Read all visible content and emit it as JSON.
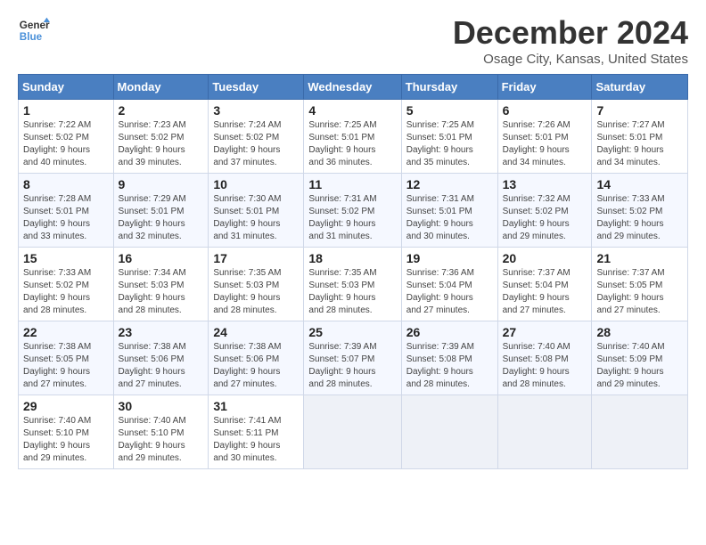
{
  "logo": {
    "line1": "General",
    "line2": "Blue"
  },
  "title": "December 2024",
  "subtitle": "Osage City, Kansas, United States",
  "days_of_week": [
    "Sunday",
    "Monday",
    "Tuesday",
    "Wednesday",
    "Thursday",
    "Friday",
    "Saturday"
  ],
  "weeks": [
    [
      {
        "day": "1",
        "info": "Sunrise: 7:22 AM\nSunset: 5:02 PM\nDaylight: 9 hours\nand 40 minutes."
      },
      {
        "day": "2",
        "info": "Sunrise: 7:23 AM\nSunset: 5:02 PM\nDaylight: 9 hours\nand 39 minutes."
      },
      {
        "day": "3",
        "info": "Sunrise: 7:24 AM\nSunset: 5:02 PM\nDaylight: 9 hours\nand 37 minutes."
      },
      {
        "day": "4",
        "info": "Sunrise: 7:25 AM\nSunset: 5:01 PM\nDaylight: 9 hours\nand 36 minutes."
      },
      {
        "day": "5",
        "info": "Sunrise: 7:25 AM\nSunset: 5:01 PM\nDaylight: 9 hours\nand 35 minutes."
      },
      {
        "day": "6",
        "info": "Sunrise: 7:26 AM\nSunset: 5:01 PM\nDaylight: 9 hours\nand 34 minutes."
      },
      {
        "day": "7",
        "info": "Sunrise: 7:27 AM\nSunset: 5:01 PM\nDaylight: 9 hours\nand 34 minutes."
      }
    ],
    [
      {
        "day": "8",
        "info": "Sunrise: 7:28 AM\nSunset: 5:01 PM\nDaylight: 9 hours\nand 33 minutes."
      },
      {
        "day": "9",
        "info": "Sunrise: 7:29 AM\nSunset: 5:01 PM\nDaylight: 9 hours\nand 32 minutes."
      },
      {
        "day": "10",
        "info": "Sunrise: 7:30 AM\nSunset: 5:01 PM\nDaylight: 9 hours\nand 31 minutes."
      },
      {
        "day": "11",
        "info": "Sunrise: 7:31 AM\nSunset: 5:02 PM\nDaylight: 9 hours\nand 31 minutes."
      },
      {
        "day": "12",
        "info": "Sunrise: 7:31 AM\nSunset: 5:01 PM\nDaylight: 9 hours\nand 30 minutes."
      },
      {
        "day": "13",
        "info": "Sunrise: 7:32 AM\nSunset: 5:02 PM\nDaylight: 9 hours\nand 29 minutes."
      },
      {
        "day": "14",
        "info": "Sunrise: 7:33 AM\nSunset: 5:02 PM\nDaylight: 9 hours\nand 29 minutes."
      }
    ],
    [
      {
        "day": "15",
        "info": "Sunrise: 7:33 AM\nSunset: 5:02 PM\nDaylight: 9 hours\nand 28 minutes."
      },
      {
        "day": "16",
        "info": "Sunrise: 7:34 AM\nSunset: 5:03 PM\nDaylight: 9 hours\nand 28 minutes."
      },
      {
        "day": "17",
        "info": "Sunrise: 7:35 AM\nSunset: 5:03 PM\nDaylight: 9 hours\nand 28 minutes."
      },
      {
        "day": "18",
        "info": "Sunrise: 7:35 AM\nSunset: 5:03 PM\nDaylight: 9 hours\nand 28 minutes."
      },
      {
        "day": "19",
        "info": "Sunrise: 7:36 AM\nSunset: 5:04 PM\nDaylight: 9 hours\nand 27 minutes."
      },
      {
        "day": "20",
        "info": "Sunrise: 7:37 AM\nSunset: 5:04 PM\nDaylight: 9 hours\nand 27 minutes."
      },
      {
        "day": "21",
        "info": "Sunrise: 7:37 AM\nSunset: 5:05 PM\nDaylight: 9 hours\nand 27 minutes."
      }
    ],
    [
      {
        "day": "22",
        "info": "Sunrise: 7:38 AM\nSunset: 5:05 PM\nDaylight: 9 hours\nand 27 minutes."
      },
      {
        "day": "23",
        "info": "Sunrise: 7:38 AM\nSunset: 5:06 PM\nDaylight: 9 hours\nand 27 minutes."
      },
      {
        "day": "24",
        "info": "Sunrise: 7:38 AM\nSunset: 5:06 PM\nDaylight: 9 hours\nand 27 minutes."
      },
      {
        "day": "25",
        "info": "Sunrise: 7:39 AM\nSunset: 5:07 PM\nDaylight: 9 hours\nand 28 minutes."
      },
      {
        "day": "26",
        "info": "Sunrise: 7:39 AM\nSunset: 5:08 PM\nDaylight: 9 hours\nand 28 minutes."
      },
      {
        "day": "27",
        "info": "Sunrise: 7:40 AM\nSunset: 5:08 PM\nDaylight: 9 hours\nand 28 minutes."
      },
      {
        "day": "28",
        "info": "Sunrise: 7:40 AM\nSunset: 5:09 PM\nDaylight: 9 hours\nand 29 minutes."
      }
    ],
    [
      {
        "day": "29",
        "info": "Sunrise: 7:40 AM\nSunset: 5:10 PM\nDaylight: 9 hours\nand 29 minutes."
      },
      {
        "day": "30",
        "info": "Sunrise: 7:40 AM\nSunset: 5:10 PM\nDaylight: 9 hours\nand 29 minutes."
      },
      {
        "day": "31",
        "info": "Sunrise: 7:41 AM\nSunset: 5:11 PM\nDaylight: 9 hours\nand 30 minutes."
      },
      {
        "day": "",
        "info": ""
      },
      {
        "day": "",
        "info": ""
      },
      {
        "day": "",
        "info": ""
      },
      {
        "day": "",
        "info": ""
      }
    ]
  ]
}
